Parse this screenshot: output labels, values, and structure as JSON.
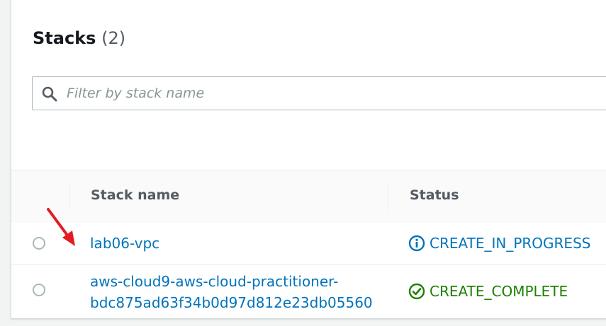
{
  "header": {
    "title": "Stacks",
    "count": "(2)"
  },
  "search": {
    "placeholder": "Filter by stack name",
    "value": ""
  },
  "table": {
    "columns": [
      "Stack name",
      "Status"
    ],
    "rows": [
      {
        "name": "lab06-vpc",
        "status": "CREATE_IN_PROGRESS",
        "status_icon": "info-icon",
        "status_color": "#0073bb"
      },
      {
        "name": "aws-cloud9-aws-cloud-practitioner-bdc875ad63f34b0d97d812e23db05560",
        "status": "CREATE_COMPLETE",
        "status_icon": "check-circle-icon",
        "status_color": "#1d8102"
      }
    ]
  },
  "colors": {
    "link": "#0073bb",
    "annotation_arrow": "#e31b23"
  }
}
